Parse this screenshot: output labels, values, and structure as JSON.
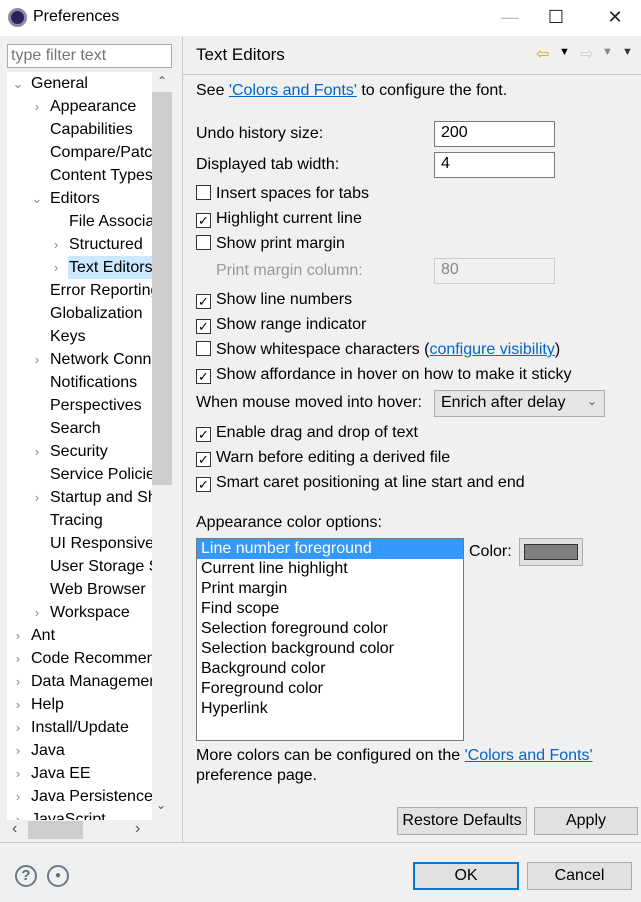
{
  "window": {
    "title": "Preferences",
    "minimize": "—",
    "maximize": "☐",
    "close": "✕"
  },
  "filter": {
    "placeholder": "type filter text"
  },
  "tree": [
    {
      "label": "General",
      "level": 0,
      "arrow": "⌄"
    },
    {
      "label": "Appearance",
      "level": 1,
      "arrow": "›"
    },
    {
      "label": "Capabilities",
      "level": 1,
      "arrow": ""
    },
    {
      "label": "Compare/Patch",
      "level": 1,
      "arrow": ""
    },
    {
      "label": "Content Types",
      "level": 1,
      "arrow": ""
    },
    {
      "label": "Editors",
      "level": 1,
      "arrow": "⌄"
    },
    {
      "label": "File Associations",
      "level": 2,
      "arrow": ""
    },
    {
      "label": "Structured",
      "level": 2,
      "arrow": "›"
    },
    {
      "label": "Text Editors",
      "level": 2,
      "arrow": "›",
      "selected": true
    },
    {
      "label": "Error Reporting",
      "level": 1,
      "arrow": ""
    },
    {
      "label": "Globalization",
      "level": 1,
      "arrow": ""
    },
    {
      "label": "Keys",
      "level": 1,
      "arrow": ""
    },
    {
      "label": "Network Connections",
      "level": 1,
      "arrow": "›"
    },
    {
      "label": "Notifications",
      "level": 1,
      "arrow": ""
    },
    {
      "label": "Perspectives",
      "level": 1,
      "arrow": ""
    },
    {
      "label": "Search",
      "level": 1,
      "arrow": ""
    },
    {
      "label": "Security",
      "level": 1,
      "arrow": "›"
    },
    {
      "label": "Service Policies",
      "level": 1,
      "arrow": ""
    },
    {
      "label": "Startup and Shutdown",
      "level": 1,
      "arrow": "›"
    },
    {
      "label": "Tracing",
      "level": 1,
      "arrow": ""
    },
    {
      "label": "UI Responsiveness",
      "level": 1,
      "arrow": ""
    },
    {
      "label": "User Storage Service",
      "level": 1,
      "arrow": ""
    },
    {
      "label": "Web Browser",
      "level": 1,
      "arrow": ""
    },
    {
      "label": "Workspace",
      "level": 1,
      "arrow": "›"
    },
    {
      "label": "Ant",
      "level": 0,
      "arrow": "›"
    },
    {
      "label": "Code Recommenders",
      "level": 0,
      "arrow": "›"
    },
    {
      "label": "Data Management",
      "level": 0,
      "arrow": "›"
    },
    {
      "label": "Help",
      "level": 0,
      "arrow": "›"
    },
    {
      "label": "Install/Update",
      "level": 0,
      "arrow": "›"
    },
    {
      "label": "Java",
      "level": 0,
      "arrow": "›"
    },
    {
      "label": "Java EE",
      "level": 0,
      "arrow": "›"
    },
    {
      "label": "Java Persistence",
      "level": 0,
      "arrow": "›"
    },
    {
      "label": "JavaScript",
      "level": 0,
      "arrow": "›"
    }
  ],
  "page": {
    "title": "Text Editors",
    "see_prefix": "See ",
    "see_link": "'Colors and Fonts'",
    "see_suffix": " to configure the font.",
    "undo_label": "Undo history size:",
    "undo_value": "200",
    "tab_label": "Displayed tab width:",
    "tab_value": "4",
    "print_margin_label": "Print margin column:",
    "print_margin_value": "80",
    "checkboxes": [
      {
        "label": "Insert spaces for tabs",
        "checked": false
      },
      {
        "label": "Highlight current line",
        "checked": true
      },
      {
        "label": "Show print margin",
        "checked": false
      },
      {
        "label": "Show line numbers",
        "checked": true
      },
      {
        "label": "Show range indicator",
        "checked": true
      },
      {
        "label": "Show whitespace characters (",
        "checked": false,
        "link": "configure visibility",
        "suffix": ")"
      },
      {
        "label": "Show affordance in hover on how to make it sticky",
        "checked": true
      },
      {
        "label": "Enable drag and drop of text",
        "checked": true
      },
      {
        "label": "Warn before editing a derived file",
        "checked": true
      },
      {
        "label": "Smart caret positioning at line start and end",
        "checked": true
      }
    ],
    "hover_label": "When mouse moved into hover:",
    "hover_value": "Enrich after delay",
    "appearance_label": "Appearance color options:",
    "color_items": [
      "Line number foreground",
      "Current line highlight",
      "Print margin",
      "Find scope",
      "Selection foreground color",
      "Selection background color",
      "Background color",
      "Foreground color",
      "Hyperlink"
    ],
    "color_label": "Color:",
    "color_value": "#808080",
    "more_prefix": "More colors can be configured on the ",
    "more_link": "'Colors and Fonts'",
    "more_suffix": "preference page.",
    "restore": "Restore Defaults",
    "apply": "Apply"
  },
  "footer": {
    "ok": "OK",
    "cancel": "Cancel",
    "help": "?"
  }
}
